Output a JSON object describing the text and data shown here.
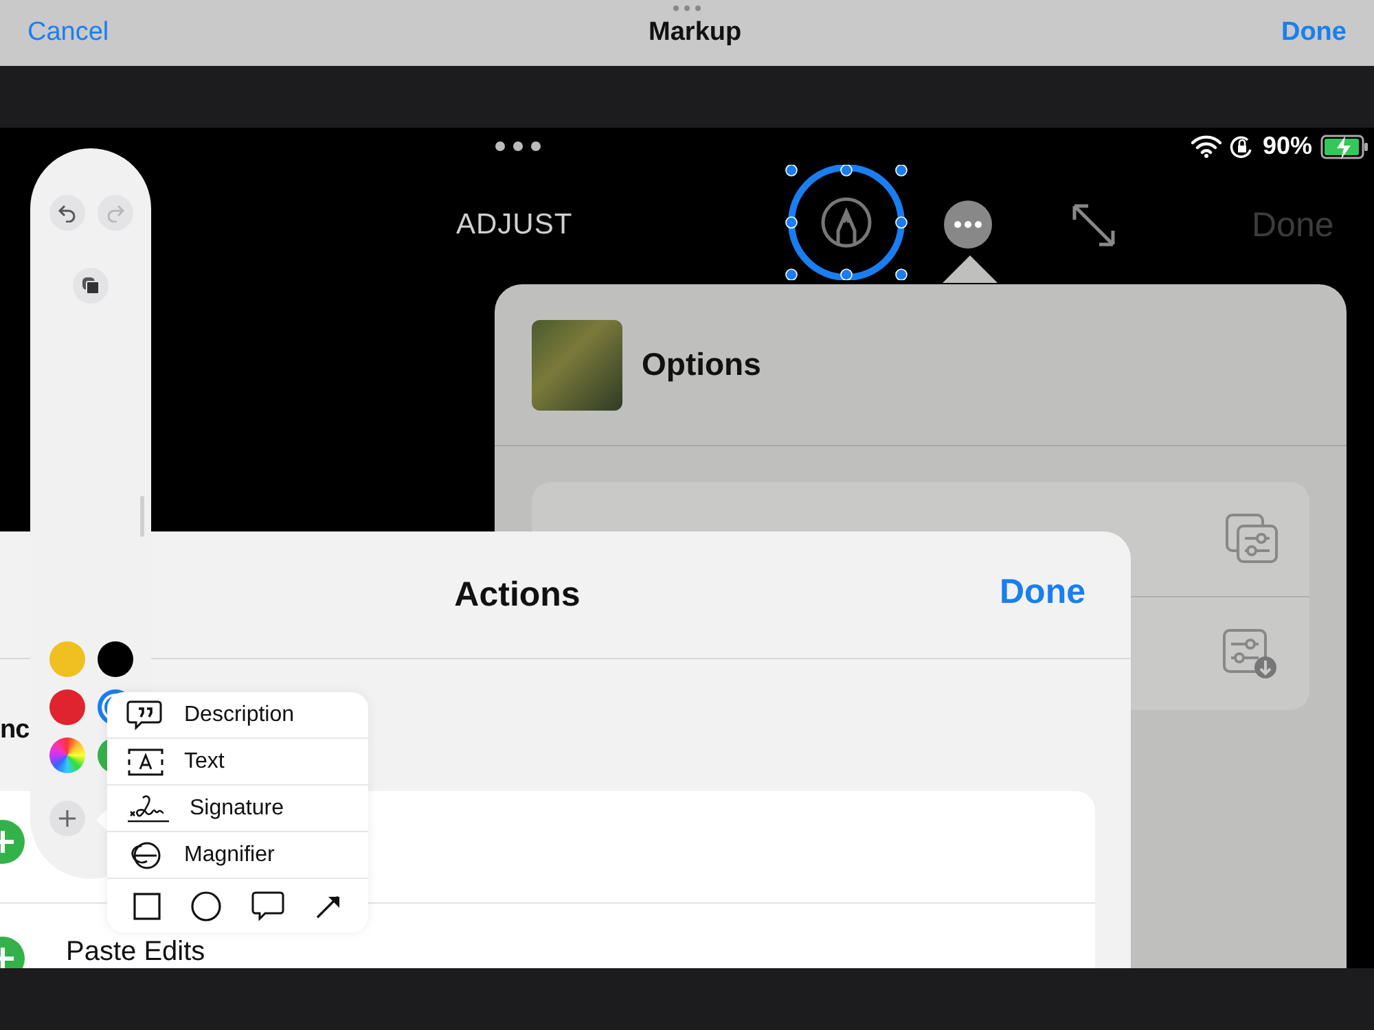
{
  "top_bar": {
    "cancel": "Cancel",
    "title": "Markup",
    "done": "Done"
  },
  "status_bar": {
    "battery": "90%"
  },
  "photo_toolbar": {
    "adjust": "ADJUST",
    "done": "Done"
  },
  "options": {
    "title": "Options"
  },
  "actions": {
    "title": "Actions",
    "done": "Done",
    "partial_text": "nc",
    "rows": [
      {
        "label": "Paste Edits"
      }
    ]
  },
  "markup_toolbar": {
    "colors": [
      {
        "kind": "swatch",
        "color": "#f0c020",
        "selected": false
      },
      {
        "kind": "swatch",
        "color": "#000000",
        "selected": false
      },
      {
        "kind": "swatch",
        "color": "#e0242f",
        "selected": false
      },
      {
        "kind": "swatch",
        "color": "#1a7ef0",
        "selected": true
      },
      {
        "kind": "wheel",
        "selected": false
      },
      {
        "kind": "swatch",
        "color": "#34b24a",
        "selected": false
      }
    ]
  },
  "add_menu": {
    "items": [
      {
        "kind": "description",
        "label": "Description"
      },
      {
        "kind": "text",
        "label": "Text"
      },
      {
        "kind": "signature",
        "label": "Signature"
      },
      {
        "kind": "magnifier",
        "label": "Magnifier"
      }
    ],
    "shapes": [
      {
        "kind": "square"
      },
      {
        "kind": "circle"
      },
      {
        "kind": "speech-bubble"
      },
      {
        "kind": "arrow"
      }
    ]
  }
}
